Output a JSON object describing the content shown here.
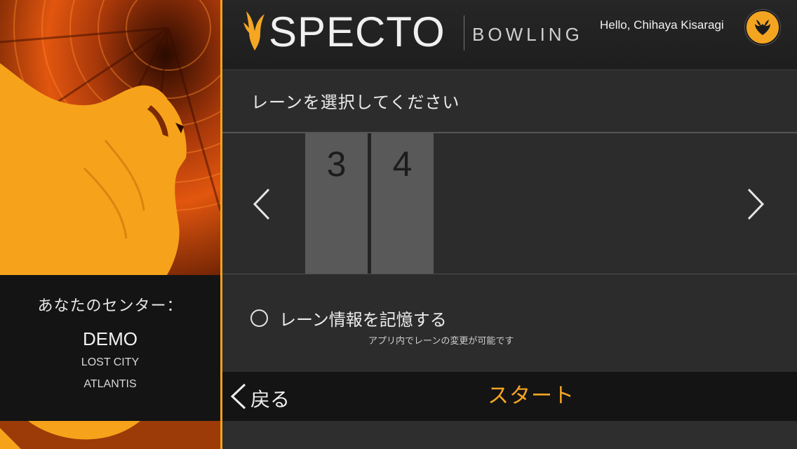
{
  "header": {
    "logo_text": "SPECTO",
    "logo_sub": "BOWLING",
    "greeting": "Hello, Chihaya Kisaragi"
  },
  "center": {
    "label": "あなたのセンター：",
    "name": "DEMO",
    "line1": "LOST CITY",
    "line2": "ATLANTIS"
  },
  "lane_picker": {
    "prompt": "レーンを選択してください",
    "lanes": [
      "3",
      "4"
    ]
  },
  "remember": {
    "label": "レーン情報を記憶する",
    "note": "アプリ内でレーンの変更が可能です",
    "checked": false
  },
  "footer": {
    "back_label": "戻る",
    "start_label": "スタート"
  },
  "colors": {
    "accent": "#f5a623",
    "background": "#2c2c2c",
    "header": "#222222",
    "footer": "#141414",
    "lane_tile": "#595959"
  }
}
